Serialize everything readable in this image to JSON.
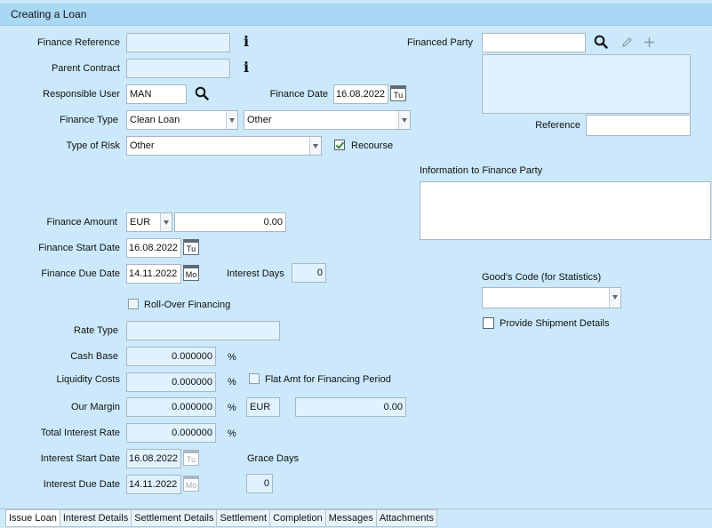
{
  "title": "Creating a Loan",
  "left": {
    "finance_reference_label": "Finance Reference",
    "parent_contract_label": "Parent Contract",
    "responsible_user_label": "Responsible User",
    "responsible_user_value": "MAN",
    "finance_date_label": "Finance Date",
    "finance_date_value": "16.08.2022",
    "finance_date_day": "Tu",
    "finance_type_label": "Finance Type",
    "finance_type_value": "Clean Loan",
    "finance_subtype_value": "Other",
    "type_of_risk_label": "Type of Risk",
    "type_of_risk_value": "Other",
    "recourse_label": "Recourse",
    "finance_amount_label": "Finance Amount",
    "finance_currency": "EUR",
    "finance_amount_value": "0.00",
    "finance_start_date_label": "Finance Start Date",
    "finance_start_date_value": "16.08.2022",
    "finance_start_date_day": "Tu",
    "finance_due_date_label": "Finance Due Date",
    "finance_due_date_value": "14.11.2022",
    "finance_due_date_day": "Mo",
    "interest_days_label": "Interest Days",
    "interest_days_value": "0",
    "rollover_label": "Roll-Over Financing",
    "rate_type_label": "Rate Type",
    "cash_base_label": "Cash Base",
    "cash_base_value": "0.000000",
    "liquidity_costs_label": "Liquidity Costs",
    "liquidity_costs_value": "0.000000",
    "flat_amt_label": "Flat Amt for Financing Period",
    "our_margin_label": "Our Margin",
    "our_margin_value": "0.000000",
    "our_margin_currency": "EUR",
    "our_margin_amount": "0.00",
    "total_interest_rate_label": "Total Interest Rate",
    "total_interest_rate_value": "0.000000",
    "percent": "%",
    "interest_start_date_label": "Interest Start Date",
    "interest_start_date_value": "16.08.2022",
    "interest_start_date_day": "Tu",
    "interest_due_date_label": "Interest Due Date",
    "interest_due_date_value": "14.11.2022",
    "interest_due_date_day": "Mo",
    "grace_days_label": "Grace Days",
    "grace_days_value": "0"
  },
  "right": {
    "financed_party_label": "Financed Party",
    "reference_label": "Reference",
    "info_to_finance_party_label": "Information to Finance Party",
    "goods_code_label": "Good's Code (for Statistics)",
    "provide_shipment_label": "Provide Shipment Details"
  },
  "tabs": [
    "Issue Loan",
    "Interest Details",
    "Settlement Details",
    "Settlement",
    "Completion",
    "Messages",
    "Attachments"
  ]
}
